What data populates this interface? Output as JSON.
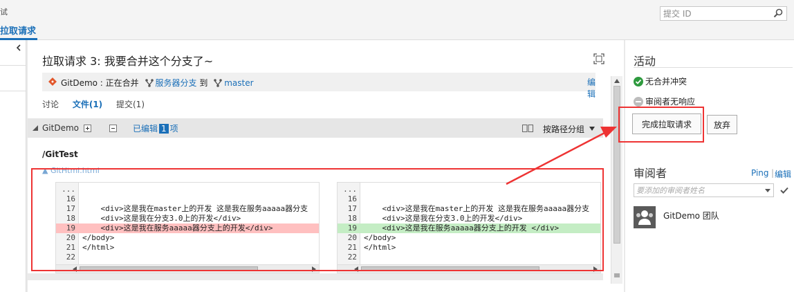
{
  "topbar": {
    "cut_text": "试",
    "tab_label": "拉取请求",
    "search_placeholder": "提交 ID"
  },
  "pr": {
    "title": "拉取请求 3: 我要合并这个分支了~",
    "status_prefix": "GitDemo : 正在合并",
    "source_branch": "服务器分支",
    "to_word": "到",
    "target_branch": "master",
    "edit_label": "编辑"
  },
  "tabs": {
    "discussion": "讨论",
    "files": "文件(1)",
    "commits": "提交(1)"
  },
  "repo_bar": {
    "repo": "GitDemo",
    "edited_pre": "已编辑",
    "edited_count": "1",
    "edited_post": "项",
    "group_by": "按路径分组"
  },
  "path": "/GitTest",
  "file_name": "GitHtml.html",
  "left_lines": [
    {
      "n": "...",
      "t": "",
      "k": ""
    },
    {
      "n": "16",
      "t": "",
      "k": ""
    },
    {
      "n": "17",
      "t": "    <div>这是我在master上的开发 这是我在服务aaaaa器分支",
      "k": ""
    },
    {
      "n": "18",
      "t": "    <div>这是我在分支3.0上的开发</div>",
      "k": ""
    },
    {
      "n": "19",
      "t": "    <div>这是我在服务aaaaa器分支上的开发</div>",
      "k": "del"
    },
    {
      "n": "20",
      "t": "</body>",
      "k": ""
    },
    {
      "n": "21",
      "t": "</html>",
      "k": ""
    },
    {
      "n": "22",
      "t": "",
      "k": ""
    }
  ],
  "right_lines": [
    {
      "n": "...",
      "t": "",
      "k": ""
    },
    {
      "n": "16",
      "t": "",
      "k": ""
    },
    {
      "n": "17",
      "t": "    <div>这是我在master上的开发 这是我在服务aaaaa器分支",
      "k": ""
    },
    {
      "n": "18",
      "t": "    <div>这是我在分支3.0上的开发</div>",
      "k": ""
    },
    {
      "n": "19",
      "t": "    <div>这是我在服务aaaaa器分支上的开发 </div>",
      "k": "add"
    },
    {
      "n": "20",
      "t": "</body>",
      "k": ""
    },
    {
      "n": "21",
      "t": "</html>",
      "k": ""
    },
    {
      "n": "22",
      "t": "",
      "k": ""
    }
  ],
  "activity": {
    "title": "活动",
    "no_conflict": "无合并冲突",
    "reviewer_no_response": "审阅者无响应",
    "complete_btn": "完成拉取请求",
    "abandon_btn": "放弃"
  },
  "reviewers": {
    "title": "审阅者",
    "ping": "Ping",
    "edit": "编辑",
    "placeholder": "要添加的审阅者姓名",
    "team": "GitDemo 团队"
  },
  "colors": {
    "accent": "#1a6fb8",
    "deleted_bg": "#ffc0c0",
    "added_bg": "#c4edc4",
    "annotation": "#e33333"
  }
}
